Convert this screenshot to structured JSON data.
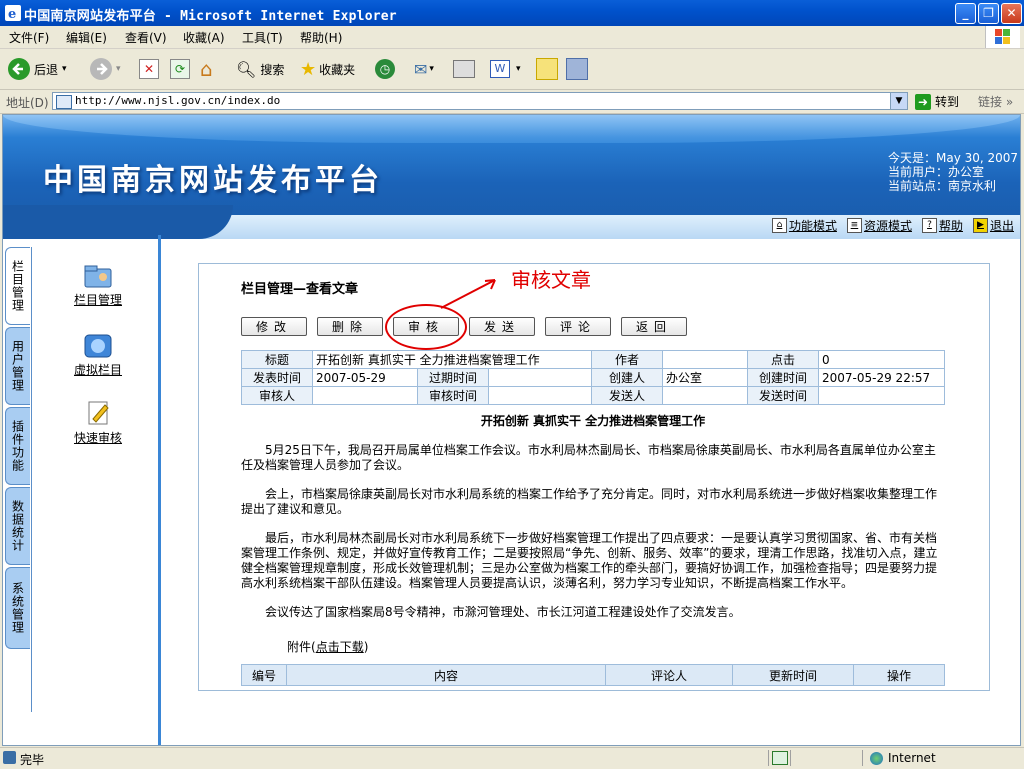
{
  "window": {
    "title": "中国南京网站发布平台 - Microsoft Internet Explorer"
  },
  "menu": [
    "文件(F)",
    "编辑(E)",
    "查看(V)",
    "收藏(A)",
    "工具(T)",
    "帮助(H)"
  ],
  "toolbar": {
    "back": "后退",
    "search": "搜索",
    "favorites": "收藏夹"
  },
  "address": {
    "label": "地址(D)",
    "url": "http://www.njsl.gov.cn/index.do",
    "go": "转到",
    "links": "链接"
  },
  "site": {
    "title": "中国南京网站发布平台",
    "today": "今天是：May 30, 2007",
    "user": "当前用户：办公室",
    "station": "当前站点：南京水利",
    "modes": [
      "功能模式",
      "资源模式",
      "帮助",
      "退出"
    ]
  },
  "nav": {
    "tabs": [
      "栏目管理",
      "用户管理",
      "插件功能",
      "数据统计",
      "系统管理"
    ],
    "items": [
      "栏目管理",
      "虚拟栏目",
      "快速审核"
    ]
  },
  "content": {
    "heading": "栏目管理—查看文章",
    "annotation": "审核文章",
    "buttons": [
      "修改",
      "删除",
      "审核",
      "发送",
      "评论",
      "返回"
    ],
    "meta": {
      "title_label": "标题",
      "title": "开拓创新  真抓实干  全力推进档案管理工作",
      "author_label": "作者",
      "author": "",
      "clicks_label": "点击",
      "clicks": "0",
      "pub_label": "发表时间",
      "pub": "2007-05-29",
      "expire_label": "过期时间",
      "expire": "",
      "creator_label": "创建人",
      "creator": "办公室",
      "created_label": "创建时间",
      "created": "2007-05-29 22:57",
      "reviewer_label": "审核人",
      "reviewer": "",
      "review_time_label": "审核时间",
      "review_time": "",
      "sender_label": "发送人",
      "sender": "",
      "send_time_label": "发送时间",
      "send_time": ""
    },
    "article": {
      "title": "开拓创新  真抓实干  全力推进档案管理工作",
      "p1": "5月25日下午，我局召开局属单位档案工作会议。市水利局林杰副局长、市档案局徐康英副局长、市水利局各直属单位办公室主任及档案管理人员参加了会议。",
      "p2": "会上，市档案局徐康英副局长对市水利局系统的档案工作给予了充分肯定。同时，对市水利局系统进一步做好档案收集整理工作提出了建议和意见。",
      "p3": "最后，市水利局林杰副局长对市水利局系统下一步做好档案管理工作提出了四点要求：一是要认真学习贯彻国家、省、市有关档案管理工作条例、规定，并做好宣传教育工作；二是要按照局“争先、创新、服务、效率”的要求，理清工作思路，找准切入点，建立健全档案管理规章制度，形成长效管理机制；三是办公室做为档案工作的牵头部门，要搞好协调工作，加强检查指导；四是要努力提高水利系统档案干部队伍建设。档案管理人员要提高认识，淡薄名利，努力学习专业知识，不断提高档案工作水平。",
      "p4": "会议传达了国家档案局8号令精神，市滁河管理处、市长江河道工程建设处作了交流发言。",
      "attach_prefix": "附件(",
      "attach_link": "点击下载",
      "attach_suffix": ")"
    },
    "comment_headers": [
      "编号",
      "内容",
      "评论人",
      "更新时间",
      "操作"
    ]
  },
  "status": {
    "text": "完毕",
    "zone": "Internet"
  }
}
